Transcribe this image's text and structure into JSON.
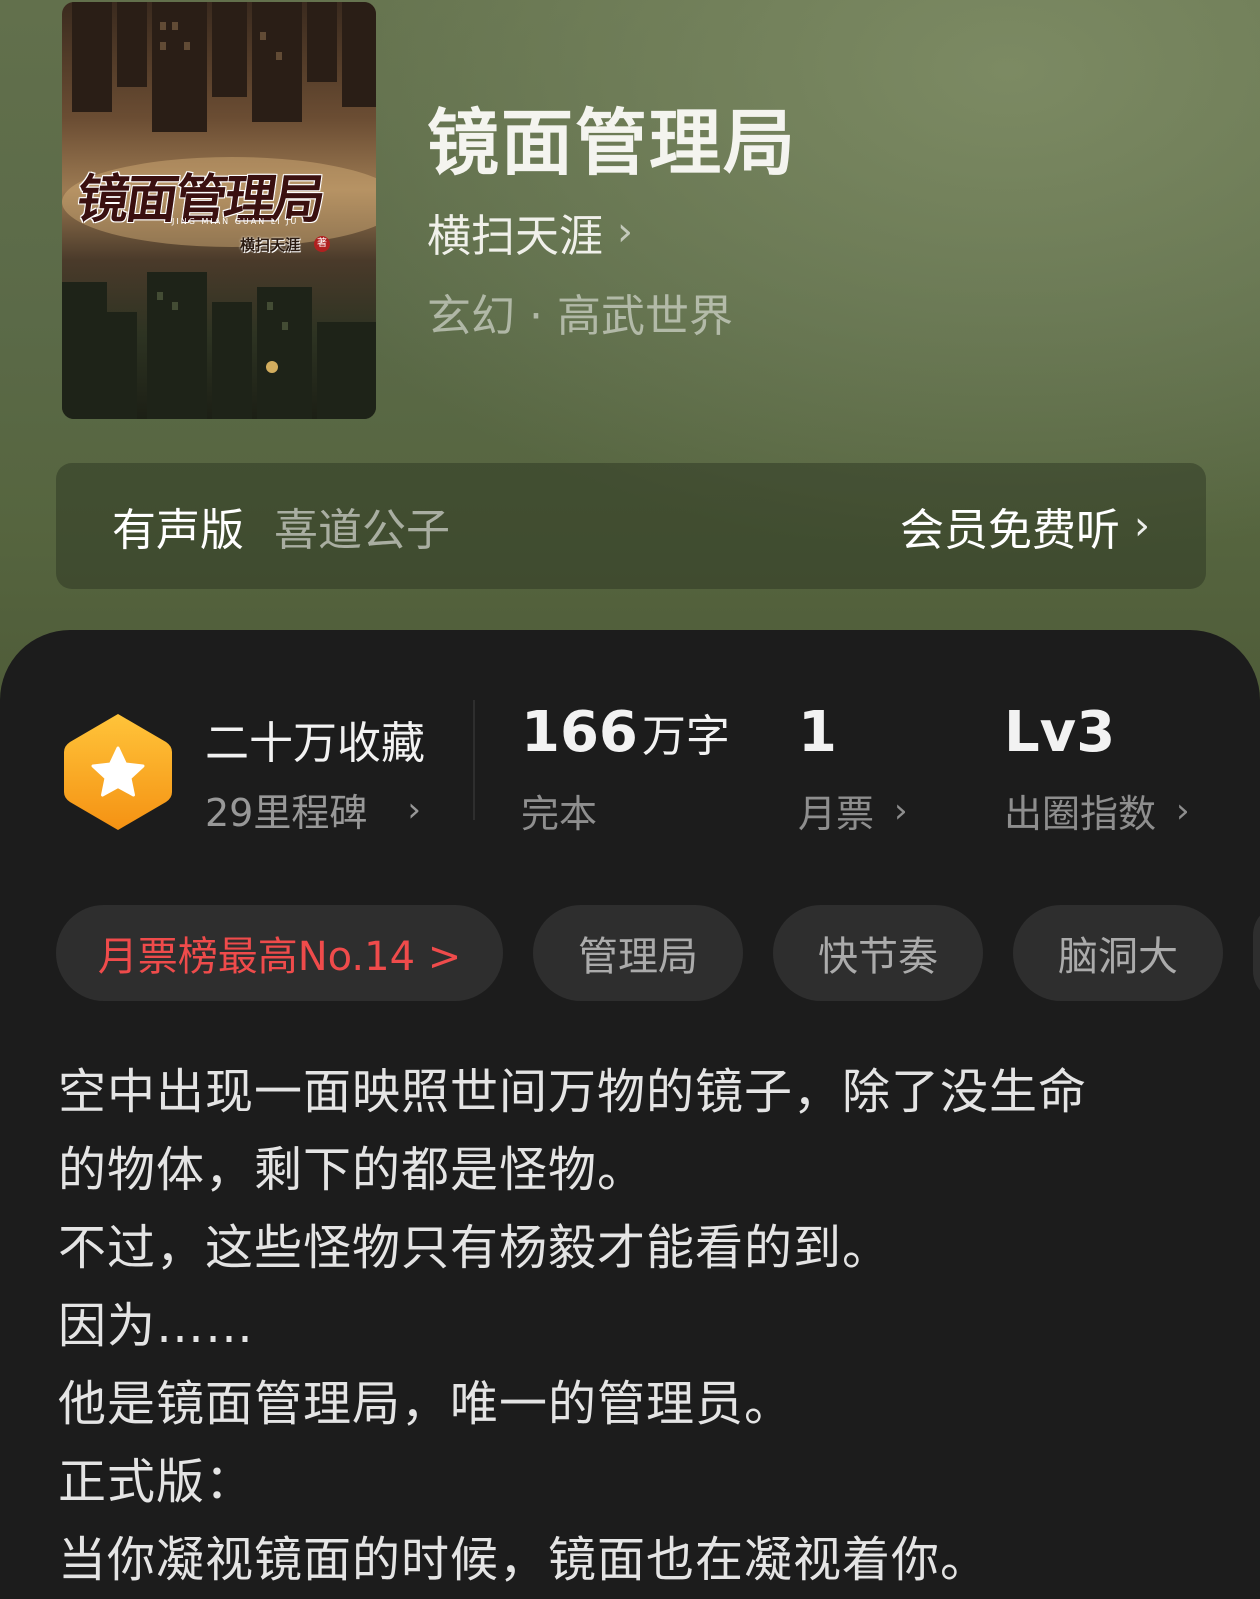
{
  "book": {
    "title": "镜面管理局",
    "author": "横扫天涯",
    "genre": "玄幻 · 高武世界",
    "cover": {
      "title": "镜面管理局",
      "pinyin": "JING MIAN GUAN LI JU",
      "author": "横扫天涯",
      "author_badge": "著"
    }
  },
  "audio": {
    "label": "有声版",
    "narrator": "喜道公子",
    "cta": "会员免费听"
  },
  "stats": {
    "favorites": "二十万收藏",
    "milestones": "29里程碑",
    "words_value": "166",
    "words_unit": "万字",
    "status": "完本",
    "monthly_votes": "1",
    "monthly_votes_label": "月票",
    "level": "Lv3",
    "level_label": "出圈指数"
  },
  "tags": {
    "rank": "月票榜最高No.14 >",
    "items": [
      "管理局",
      "快节奏",
      "脑洞大"
    ]
  },
  "intro": [
    "空中出现一面映照世间万物的镜子，除了没生命",
    "的物体，剩下的都是怪物。",
    "不过，这些怪物只有杨毅才能看的到。",
    "因为……",
    "他是镜面管理局，唯一的管理员。",
    "正式版：",
    "当你凝视镜面的时候，镜面也在凝视着你。"
  ],
  "colors": {
    "accent_red": "#ef4b4b",
    "badge_orange": "#f7a21b",
    "header_green": "#5b6a48"
  }
}
